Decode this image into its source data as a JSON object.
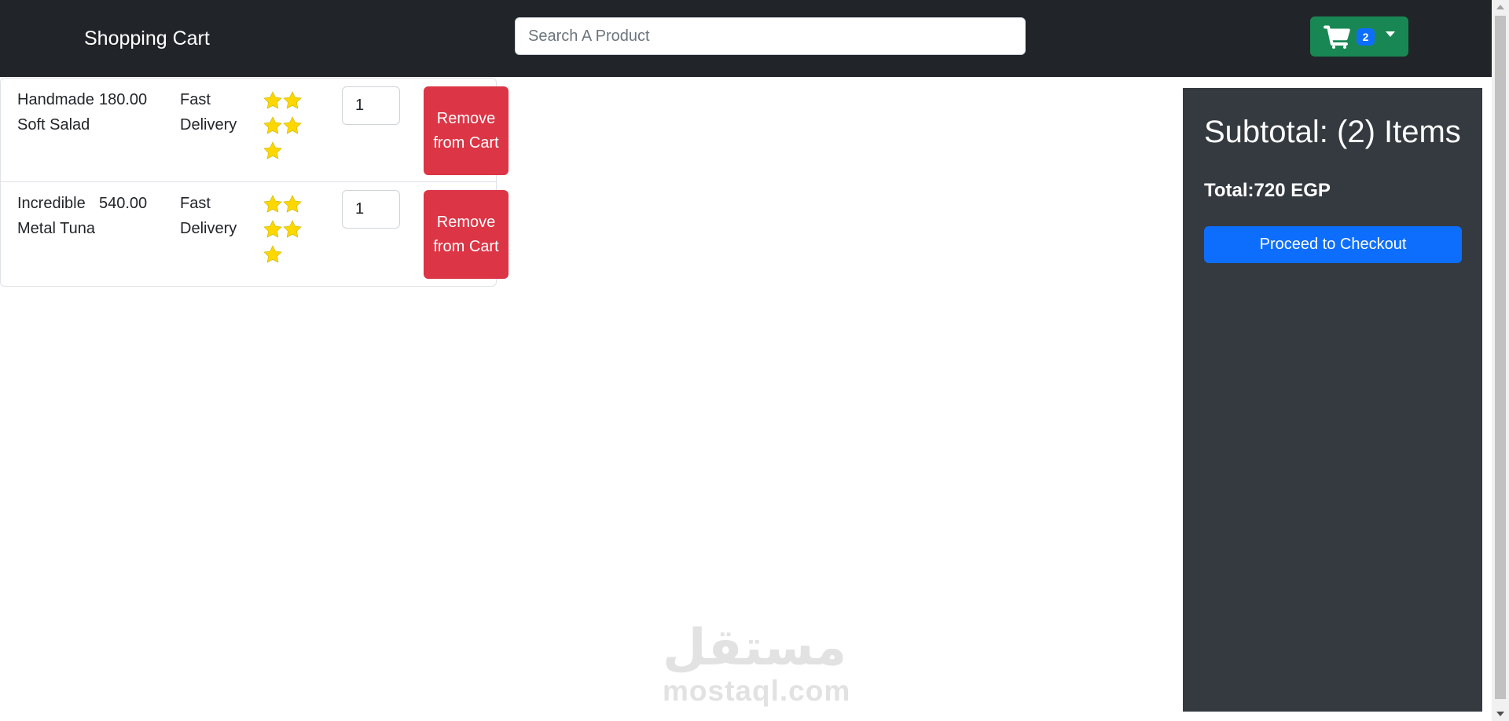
{
  "navbar": {
    "brand": "Shopping Cart",
    "search_placeholder": "Search A Product",
    "cart_count": "2",
    "cart_icon": "cart-icon",
    "dropdown_icon": "chevron-down-icon"
  },
  "cart": {
    "items": [
      {
        "name": "Handmade Soft Salad",
        "price": "180.00",
        "delivery": "Fast Delivery",
        "rating": 5,
        "quantity": "1",
        "remove_label": "Remove from Cart"
      },
      {
        "name": "Incredible Metal Tuna",
        "price": "540.00",
        "delivery": "Fast Delivery",
        "rating": 5,
        "quantity": "1",
        "remove_label": "Remove from Cart"
      }
    ]
  },
  "summary": {
    "subtotal": "Subtotal: (2) Items",
    "total": "Total:720 EGP",
    "checkout_label": "Proceed to Checkout"
  },
  "watermark": {
    "arabic": "مستقل",
    "latin": "mostaql.com"
  },
  "colors": {
    "navbar_bg": "#212529",
    "cart_button": "#198754",
    "badge": "#0d6efd",
    "remove_button": "#dc3545",
    "checkout_button": "#0d6efd",
    "summary_bg": "#343a40",
    "star": "#ffd700"
  }
}
